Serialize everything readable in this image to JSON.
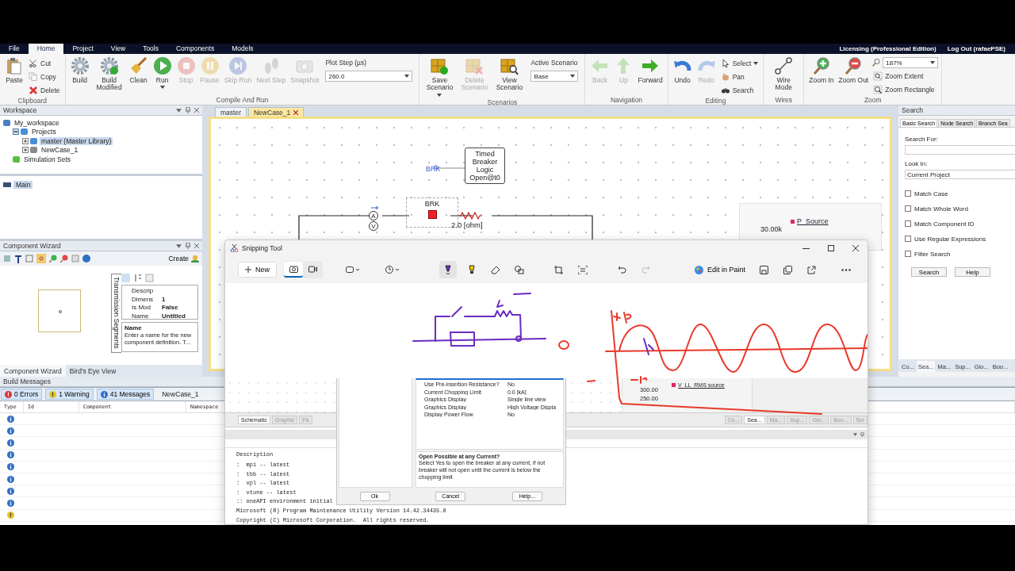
{
  "menu": {
    "tabs": [
      {
        "label": "File",
        "selected": false
      },
      {
        "label": "Home",
        "selected": true
      },
      {
        "label": "Project",
        "selected": false
      },
      {
        "label": "View",
        "selected": false
      },
      {
        "label": "Tools",
        "selected": false
      },
      {
        "label": "Components",
        "selected": false
      },
      {
        "label": "Models",
        "selected": false
      }
    ],
    "licensing": "Licensing (Professional Edition)",
    "logout": "Log Out (rafaePSE)"
  },
  "ribbon": [
    {
      "title": "Clipboard",
      "items": [
        {
          "kind": "large",
          "label": "Paste",
          "disabled": false,
          "dropdown": false
        },
        {
          "kind": "small",
          "label": "Cut",
          "disabled": false,
          "dropdown": false
        },
        {
          "kind": "small",
          "label": "Copy",
          "disabled": false,
          "dropdown": false
        },
        {
          "kind": "small",
          "label": "Delete",
          "disabled": false,
          "dropdown": false
        }
      ]
    },
    {
      "title": "Compile And Run",
      "items": [
        {
          "kind": "large",
          "label": "Build",
          "disabled": false,
          "dropdown": false
        },
        {
          "kind": "large",
          "label": "Build Modified",
          "disabled": false,
          "dropdown": false
        },
        {
          "kind": "large",
          "label": "Clean",
          "disabled": false,
          "dropdown": false
        },
        {
          "kind": "large",
          "label": "Run",
          "disabled": false,
          "dropdown": true
        },
        {
          "kind": "large",
          "label": "Stop",
          "disabled": true,
          "dropdown": false
        },
        {
          "kind": "large",
          "label": "Pause",
          "disabled": true,
          "dropdown": false
        },
        {
          "kind": "large",
          "label": "Skip Run",
          "disabled": true,
          "dropdown": false
        },
        {
          "kind": "large",
          "label": "Next Step",
          "disabled": true,
          "dropdown": false
        },
        {
          "kind": "large",
          "label": "Snapshot",
          "disabled": true,
          "dropdown": false
        },
        {
          "kind": "field",
          "label": "Plot Step (µs)",
          "value": "260.0",
          "disabled": false,
          "dropdown": true
        }
      ]
    },
    {
      "title": "Scenarios",
      "items": [
        {
          "kind": "large",
          "label": "Save Scenario",
          "disabled": false,
          "dropdown": true
        },
        {
          "kind": "large",
          "label": "Delete Scenario",
          "disabled": true,
          "dropdown": false
        },
        {
          "kind": "large",
          "label": "View Scenario",
          "disabled": false,
          "dropdown": false
        },
        {
          "kind": "field",
          "label": "Active Scenario",
          "value": "Base",
          "disabled": false,
          "dropdown": true
        }
      ]
    },
    {
      "title": "Navigation",
      "items": [
        {
          "kind": "large",
          "label": "Back",
          "disabled": true,
          "dropdown": false
        },
        {
          "kind": "large",
          "label": "Up",
          "disabled": true,
          "dropdown": false
        },
        {
          "kind": "large",
          "label": "Forward",
          "disabled": false,
          "dropdown": false
        }
      ]
    },
    {
      "title": "Editing",
      "items": [
        {
          "kind": "large",
          "label": "Undo",
          "disabled": false,
          "dropdown": false
        },
        {
          "kind": "large",
          "label": "Redo",
          "disabled": true,
          "dropdown": false
        },
        {
          "kind": "small",
          "label": "Select",
          "disabled": false,
          "dropdown": true
        },
        {
          "kind": "small",
          "label": "Pan",
          "disabled": false,
          "dropdown": false
        },
        {
          "kind": "small",
          "label": "Search",
          "disabled": false,
          "dropdown": false
        }
      ]
    },
    {
      "title": "Wires",
      "items": [
        {
          "kind": "large",
          "label": "Wire Mode",
          "disabled": false,
          "dropdown": false
        }
      ]
    },
    {
      "title": "Zoom",
      "items": [
        {
          "kind": "large",
          "label": "Zoom In",
          "disabled": false,
          "dropdown": false
        },
        {
          "kind": "large",
          "label": "Zoom Out",
          "disabled": false,
          "dropdown": false
        },
        {
          "kind": "combo",
          "value": "187%",
          "disabled": false,
          "dropdown": true
        },
        {
          "kind": "small",
          "label": "Zoom Extent",
          "disabled": false,
          "dropdown": false
        },
        {
          "kind": "small",
          "label": "Zoom Rectangle",
          "disabled": false,
          "dropdown": false
        }
      ]
    }
  ],
  "workspace": {
    "title": "Workspace",
    "tree": [
      {
        "label": "My_workspace",
        "selected": false,
        "children": [
          {
            "label": "Projects",
            "selected": false,
            "expanded": true,
            "children": [
              {
                "label": "master (Master Library)",
                "selected": true,
                "expanded": false
              },
              {
                "label": "NewCase_1",
                "selected": false,
                "expanded": false
              }
            ]
          },
          {
            "label": "Simulation Sets",
            "selected": false
          }
        ]
      }
    ],
    "outline": [
      {
        "label": "Main",
        "selected": true
      }
    ]
  },
  "component_wizard": {
    "title": "Component Wizard",
    "create": "Create",
    "side_tab": "Transmission Segments",
    "properties": [
      {
        "name": "Descrip"
      },
      {
        "name": "Dimens",
        "value": "1"
      },
      {
        "name": "Is Mod",
        "value": "False"
      },
      {
        "name": "Name",
        "value": "Untitled"
      }
    ],
    "help_title": "Name",
    "help_text": "Enter a name for the new component definition. T...",
    "tabs": [
      {
        "label": "Component Wizard",
        "selected": true
      },
      {
        "label": "Bird's Eye View",
        "selected": false
      }
    ]
  },
  "documents": {
    "tabs": [
      {
        "label": "master",
        "selected": false
      },
      {
        "label": "NewCase_1",
        "selected": true
      }
    ]
  },
  "schematic": {
    "logic_block": [
      "Timed",
      "Breaker",
      "Logic",
      "Open@t0"
    ],
    "signal_label": "BRK",
    "breaker_label": "BRK",
    "meters": [
      "A",
      "V"
    ],
    "resistor_value": "2.0 [ohm]",
    "plot": {
      "legend": "P_Source",
      "tick": "30.00k"
    }
  },
  "search_panel": {
    "title": "Search",
    "tabs": [
      {
        "label": "Basic Search",
        "selected": true
      },
      {
        "label": "Node Search",
        "selected": false
      },
      {
        "label": "Branch Sea",
        "selected": false
      }
    ],
    "search_for": "Search For:",
    "look_in": "Look In:",
    "look_in_value": "Current Project",
    "options": [
      {
        "label": "Match Case",
        "checked": false
      },
      {
        "label": "Match Whole Word",
        "checked": false
      },
      {
        "label": "Match Component ID",
        "checked": false
      },
      {
        "label": "Use Regular Expressions",
        "checked": false
      },
      {
        "label": "Filter Search",
        "checked": false
      }
    ],
    "buttons": [
      "Search",
      "Help"
    ],
    "panel_tabs": [
      {
        "label": "Co...",
        "selected": false
      },
      {
        "label": "Sea...",
        "selected": true
      },
      {
        "label": "Ma...",
        "selected": false
      },
      {
        "label": "Sup...",
        "selected": false
      },
      {
        "label": "Glo...",
        "selected": false
      },
      {
        "label": "Boo...",
        "selected": false
      }
    ]
  },
  "build_messages": {
    "title": "Build Messages",
    "filters": [
      {
        "kind": "error",
        "label": "0 Errors",
        "on": true
      },
      {
        "kind": "warning",
        "label": "1 Warning",
        "on": true
      },
      {
        "kind": "info",
        "label": "41 Messages",
        "on": true
      }
    ],
    "project": "NewCase_1",
    "columns": [
      "Type",
      "Id",
      "Component",
      "Namespace"
    ],
    "rows": [
      {
        "kind": "info"
      },
      {
        "kind": "info"
      },
      {
        "kind": "info"
      },
      {
        "kind": "info"
      },
      {
        "kind": "info"
      },
      {
        "kind": "info"
      },
      {
        "kind": "info"
      },
      {
        "kind": "info"
      },
      {
        "kind": "warning"
      }
    ]
  },
  "snipping_tool": {
    "title": "Snipping Tool",
    "new": "New",
    "capture_modes": [
      {
        "selected": true
      },
      {
        "selected": false
      }
    ],
    "pen_tools": [
      {
        "selected": true
      },
      {
        "selected": false
      },
      {
        "selected": false
      },
      {
        "selected": false
      }
    ],
    "edit_in_paint": "Edit in Paint",
    "capture": {
      "plot": {
        "legend": "V_LL_RMS source",
        "ticks": [
          "300.00",
          "250.00"
        ]
      },
      "view_tabs": [
        {
          "label": "Schematic",
          "selected": true
        },
        {
          "label": "Graphic",
          "selected": false
        },
        {
          "label": "Pa",
          "selected": false
        }
      ],
      "panel_tabs": [
        {
          "label": "Co...",
          "selected": false
        },
        {
          "label": "Sea...",
          "selected": true
        },
        {
          "label": "Ma...",
          "selected": false
        },
        {
          "label": "Sup...",
          "selected": false
        },
        {
          "label": "Glo...",
          "selected": false
        },
        {
          "label": "Boo...",
          "selected": false
        },
        {
          "label": "Scr",
          "selected": false
        }
      ],
      "console_header": "Description",
      "console": [
        ":  mpi -- latest",
        ":  tbb -- latest",
        ":  vpl -- latest",
        ":  vtune -- latest",
        ":: oneAPI environment initial",
        "Microsoft (R) Program Maintenance Utility Version 14.42.34435.0",
        "Copyright (C) Microsoft Corporation.  All rights reserved."
      ],
      "dialog": {
        "properties": [
          {
            "name": "Use Pre-insertion Resistance?",
            "value": "No"
          },
          {
            "name": "Current Chopping Limit",
            "value": "0.0 [kA]"
          },
          {
            "name": "Graphics Display",
            "value": "Single line view"
          },
          {
            "name": "Graphics Display",
            "value": "High Voltage Displa"
          },
          {
            "name": "Display Power Flow",
            "value": "No"
          }
        ],
        "help_title": "Open Possible at any Current?",
        "help_text": "Select Yes to open the breaker at any current, if not breaker will not open until the current is below the chopping limit",
        "buttons": [
          "Ok",
          "Cancel",
          "Help..."
        ]
      }
    }
  }
}
